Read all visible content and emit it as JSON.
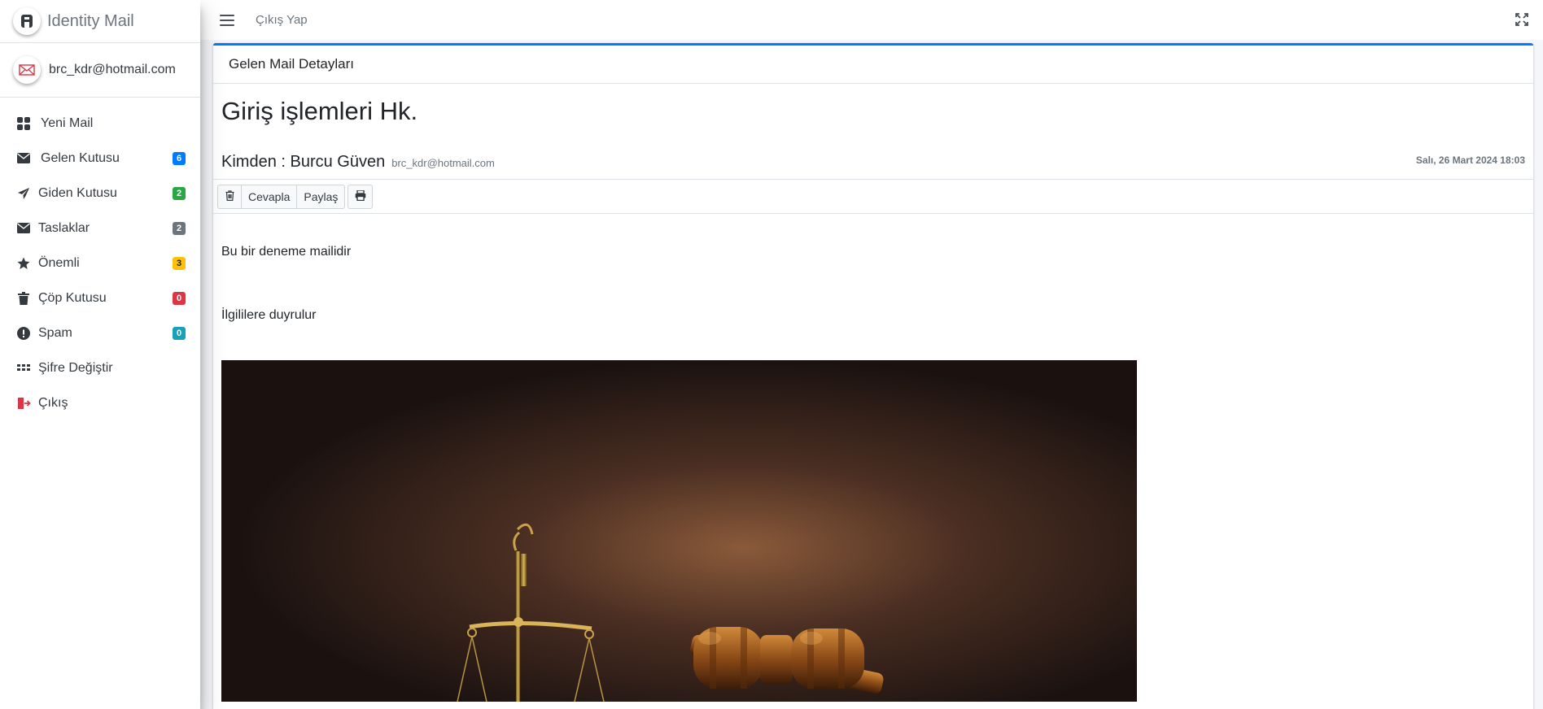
{
  "app": {
    "brand_name": "Identity Mail",
    "brand_icon": "letter-a-logo-icon",
    "user_email": "brc_kdr@hotmail.com"
  },
  "sidebar": {
    "items": [
      {
        "label": "Yeni Mail",
        "icon": "grid-icon",
        "badge": null
      },
      {
        "label": "Gelen Kutusu",
        "icon": "envelope-icon",
        "badge": "6",
        "badge_color": "#007bff"
      },
      {
        "label": "Giden Kutusu",
        "icon": "paper-plane-icon",
        "badge": "2",
        "badge_color": "#28a745"
      },
      {
        "label": "Taslaklar",
        "icon": "envelope-icon",
        "badge": "2",
        "badge_color": "#6c757d"
      },
      {
        "label": "Önemli",
        "icon": "star-icon",
        "badge": "3",
        "badge_color": "#ffc107"
      },
      {
        "label": "Çöp Kutusu",
        "icon": "trash-icon",
        "badge": "0",
        "badge_color": "#dc3545"
      },
      {
        "label": "Spam",
        "icon": "exclamation-circle-icon",
        "badge": "0",
        "badge_color": "#17a2b8"
      },
      {
        "label": "Şifre Değiştir",
        "icon": "keypad-icon",
        "badge": null
      },
      {
        "label": "Çıkış",
        "icon": "sign-out-icon",
        "badge": null
      }
    ]
  },
  "topbar": {
    "logout_label": "Çıkış Yap"
  },
  "mail": {
    "card_title": "Gelen Mail Detayları",
    "subject": "Giriş işlemleri Hk.",
    "from_prefix": "Kimden : ",
    "from_name": "Burcu Güven",
    "from_email": "brc_kdr@hotmail.com",
    "date": "Salı, 26 Mart 2024 18:03",
    "body_line1": "Bu bir deneme mailidir",
    "body_line2": "İlgililere duyrulur",
    "attachment_image": "scales-of-justice-and-gavel-image"
  },
  "toolbar": {
    "delete_icon": "trash-icon",
    "reply_label": "Cevapla",
    "share_label": "Paylaş",
    "print_icon": "print-icon"
  },
  "colors": {
    "accent": "#007bff",
    "danger": "#dc3545"
  }
}
